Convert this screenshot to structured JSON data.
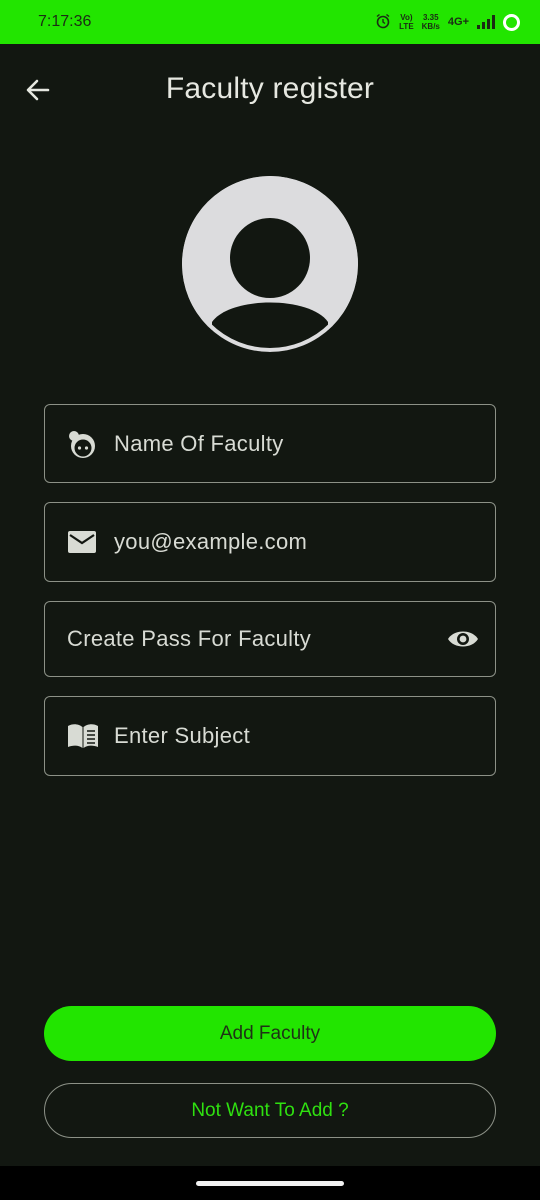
{
  "status_bar": {
    "time": "7:17:36",
    "volte_top": "Vo)",
    "volte_bottom": "LTE",
    "speed_value": "3.35",
    "speed_unit": "KB/s",
    "network": "4G+"
  },
  "app_bar": {
    "title": "Faculty register",
    "back_icon": "arrow-left-icon"
  },
  "avatar": {
    "icon": "person-avatar-icon"
  },
  "form": {
    "name": {
      "placeholder": "Name Of Faculty",
      "icon": "face-icon"
    },
    "email": {
      "placeholder": "you@example.com",
      "icon": "mail-icon"
    },
    "password": {
      "placeholder": "Create Pass For Faculty",
      "toggle_icon": "eye-icon"
    },
    "subject": {
      "placeholder": "Enter Subject",
      "icon": "book-icon"
    }
  },
  "actions": {
    "add_label": "Add Faculty",
    "cancel_label": "Not Want To Add ?"
  },
  "colors": {
    "accent": "#22e500",
    "background": "#121711",
    "border": "#8c9187"
  }
}
